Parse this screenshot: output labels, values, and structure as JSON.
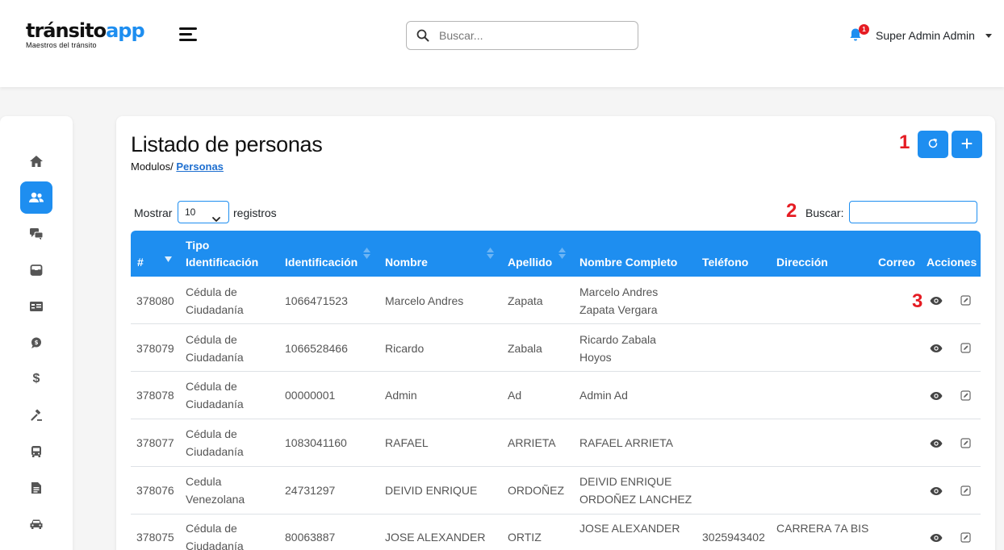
{
  "app": {
    "logo_text_dark": "tránsito",
    "logo_text_blue": "app",
    "logo_tagline": "Maestros del tránsito"
  },
  "header": {
    "search_placeholder": "Buscar...",
    "notification_count": "1",
    "user_name": "Super Admin Admin"
  },
  "sidebar": {
    "items": [
      {
        "icon": "home-icon",
        "active": false
      },
      {
        "icon": "users-icon",
        "active": true
      },
      {
        "icon": "chat-icon",
        "active": false
      },
      {
        "icon": "inbox-icon",
        "active": false
      },
      {
        "icon": "id-card-icon",
        "active": false
      },
      {
        "icon": "message-icon",
        "active": false
      },
      {
        "icon": "dollar-icon",
        "active": false,
        "glyph": "$"
      },
      {
        "icon": "gavel-icon",
        "active": false
      },
      {
        "icon": "bus-icon",
        "active": false
      },
      {
        "icon": "document-icon",
        "active": false
      },
      {
        "icon": "car-icon",
        "active": false
      }
    ]
  },
  "page": {
    "title": "Listado de personas",
    "breadcrumb_prefix": "Modulos/",
    "breadcrumb_current": "Personas",
    "markers": {
      "one": "1",
      "two": "2",
      "three": "3"
    }
  },
  "toolbar": {
    "refresh_icon": "refresh-icon",
    "add_icon": "plus-icon"
  },
  "controls": {
    "show_label": "Mostrar",
    "page_size": "10",
    "records_label": "registros",
    "search_label": "Buscar:"
  },
  "table": {
    "headers": {
      "num": "#",
      "tipo_line1": "Tipo",
      "tipo_line2": "Identificación",
      "identificacion": "Identificación",
      "nombre": "Nombre",
      "apellido": "Apellido",
      "nombre_completo": "Nombre Completo",
      "telefono": "Teléfono",
      "direccion": "Dirección",
      "correo": "Correo",
      "acciones": "Acciones"
    },
    "rows": [
      {
        "num": "378080",
        "tipo1": "Cédula de",
        "tipo2": "Ciudadanía",
        "ident": "1066471523",
        "nombre": "Marcelo Andres",
        "apellido": "Zapata",
        "full1": "Marcelo Andres",
        "full2": "Zapata Vergara",
        "tel": "",
        "dir1": "",
        "dir2": "",
        "correo": ""
      },
      {
        "num": "378079",
        "tipo1": "Cédula de",
        "tipo2": "Ciudadanía",
        "ident": "1066528466",
        "nombre": "Ricardo",
        "apellido": "Zabala",
        "full1": "Ricardo Zabala",
        "full2": "Hoyos",
        "tel": "",
        "dir1": "",
        "dir2": "",
        "correo": ""
      },
      {
        "num": "378078",
        "tipo1": "Cédula de",
        "tipo2": "Ciudadanía",
        "ident": "00000001",
        "nombre": "Admin",
        "apellido": "Ad",
        "full1": "Admin Ad",
        "full2": "",
        "tel": "",
        "dir1": "",
        "dir2": "",
        "correo": ""
      },
      {
        "num": "378077",
        "tipo1": "Cédula de",
        "tipo2": "Ciudadanía",
        "ident": "1083041160",
        "nombre": "RAFAEL",
        "apellido": "ARRIETA",
        "full1": "RAFAEL ARRIETA",
        "full2": "",
        "tel": "",
        "dir1": "",
        "dir2": "",
        "correo": ""
      },
      {
        "num": "378076",
        "tipo1": "Cedula",
        "tipo2": "Venezolana",
        "ident": "24731297",
        "nombre": "DEIVID ENRIQUE",
        "apellido": "ORDOÑEZ",
        "full1": "DEIVID ENRIQUE",
        "full2": "ORDOÑEZ LANCHEZ",
        "tel": "",
        "dir1": "",
        "dir2": "",
        "correo": ""
      },
      {
        "num": "378075",
        "tipo1": "Cédula de",
        "tipo2": "Ciudadanía",
        "ident": "80063887",
        "nombre": "JOSE ALEXANDER",
        "apellido": "ORTIZ",
        "full1": "JOSE ALEXANDER",
        "full2": "",
        "tel": "3025943402",
        "dir1": "CARRERA 7A BIS",
        "dir2": "",
        "correo": ""
      }
    ]
  },
  "colors": {
    "primary": "#1e8ef0",
    "marker_red": "#e51c23"
  }
}
